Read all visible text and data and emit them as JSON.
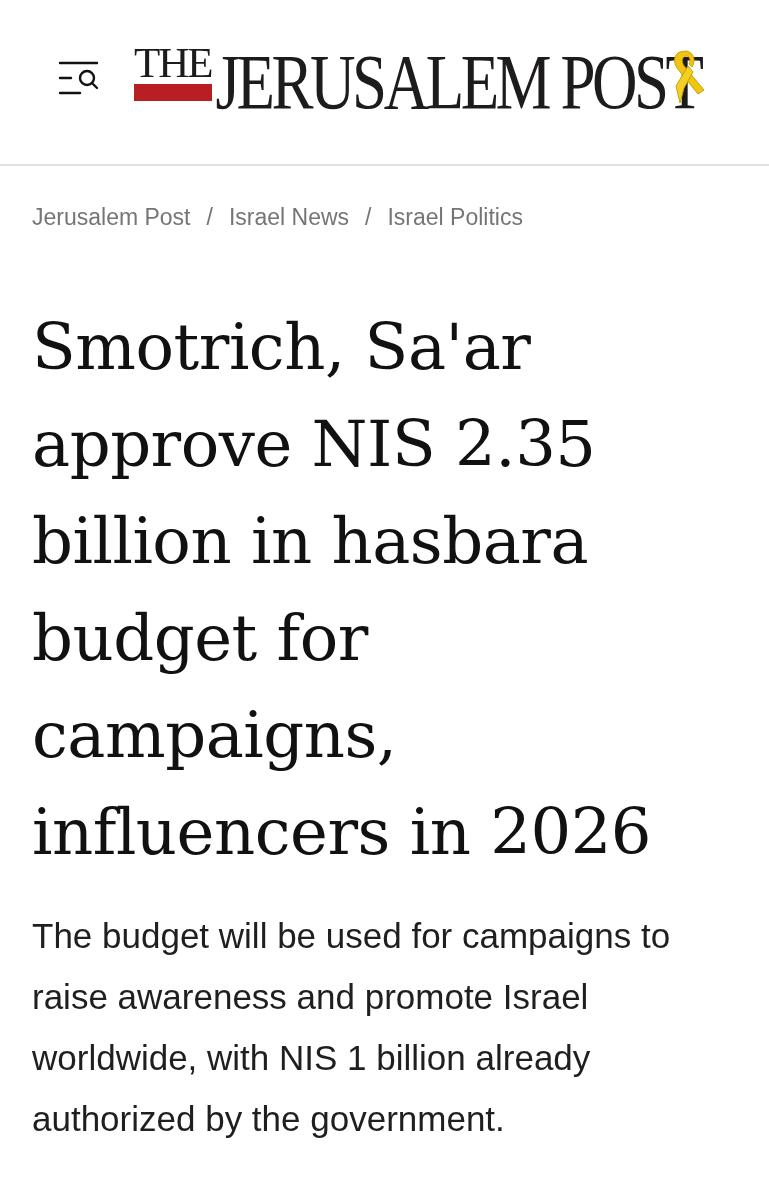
{
  "logo": {
    "prefix": "THE",
    "name": "JERUSALEM POST"
  },
  "breadcrumb": [
    {
      "label": "Jerusalem Post",
      "separator": "/"
    },
    {
      "label": "Israel News",
      "separator": "/"
    },
    {
      "label": "Israel Politics"
    }
  ],
  "headline": "Smotrich, Sa'ar approve NIS 2.35 billion in hasbara budget for campaigns, influencers in 2026",
  "summary": "The budget will be used for campaigns to raise awareness and promote Israel worldwide, with NIS 1 billion already authorized by the government."
}
